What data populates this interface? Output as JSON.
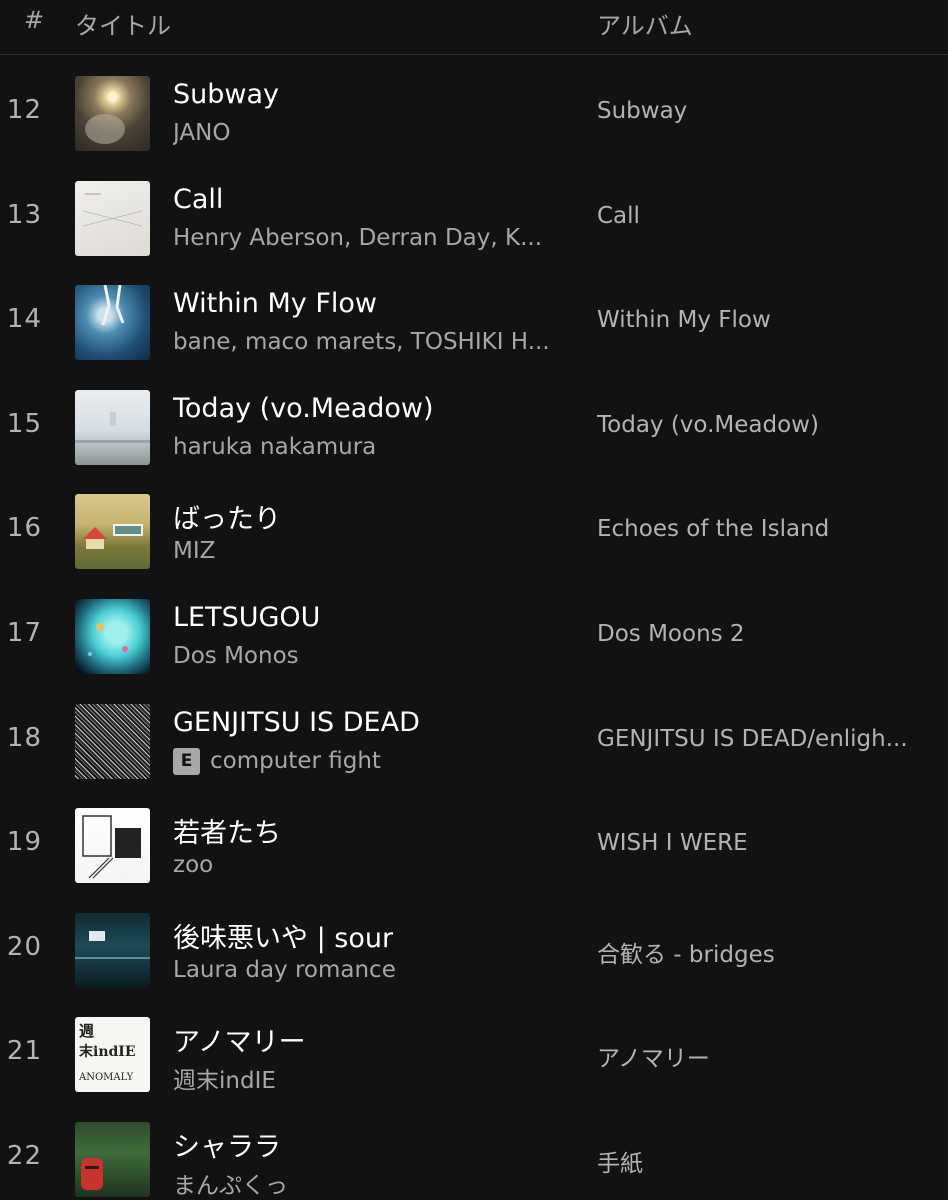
{
  "header": {
    "num_label": "#",
    "title_label": "タイトル",
    "album_label": "アルバム"
  },
  "tracks": [
    {
      "num": "12",
      "title": "Subway",
      "artist": "JANO",
      "album": "Subway",
      "explicit": false
    },
    {
      "num": "13",
      "title": "Call",
      "artist": "Henry Aberson, Derran Day, K...",
      "album": "Call",
      "explicit": false
    },
    {
      "num": "14",
      "title": "Within My Flow",
      "artist": "bane, maco marets, TOSHIKI H...",
      "album": "Within My Flow",
      "explicit": false
    },
    {
      "num": "15",
      "title": "Today (vo.Meadow)",
      "artist": "haruka nakamura",
      "album": "Today (vo.Meadow)",
      "explicit": false
    },
    {
      "num": "16",
      "title": "ばったり",
      "artist": "MIZ",
      "album": "Echoes of the Island",
      "explicit": false
    },
    {
      "num": "17",
      "title": "LETSUGOU",
      "artist": "Dos Monos",
      "album": "Dos Moons 2",
      "explicit": false
    },
    {
      "num": "18",
      "title": "GENJITSU IS DEAD",
      "artist": "computer fight",
      "album": "GENJITSU IS DEAD/enligh...",
      "explicit": true,
      "explicit_label": "E"
    },
    {
      "num": "19",
      "title": "若者たち",
      "artist": "zoo",
      "album": "WISH I WERE",
      "explicit": false
    },
    {
      "num": "20",
      "title": "後味悪いや | sour",
      "artist": "Laura day romance",
      "album": "合歓る - bridges",
      "explicit": false
    },
    {
      "num": "21",
      "title": "アノマリー",
      "artist": "週末indIE",
      "album": "アノマリー",
      "explicit": false,
      "cover_text": [
        "週",
        "末indIE",
        "ANOMALY"
      ]
    },
    {
      "num": "22",
      "title": "シャララ",
      "artist": "まんぷくっ",
      "album": "手紙",
      "explicit": false
    }
  ],
  "icons": {
    "cover_art": "album-cover-icon",
    "explicit": "explicit-badge-icon"
  },
  "colors": {
    "background": "#121212",
    "primary_text": "#ffffff",
    "secondary_text": "#a7a7a7",
    "divider": "#2c2c2c"
  }
}
